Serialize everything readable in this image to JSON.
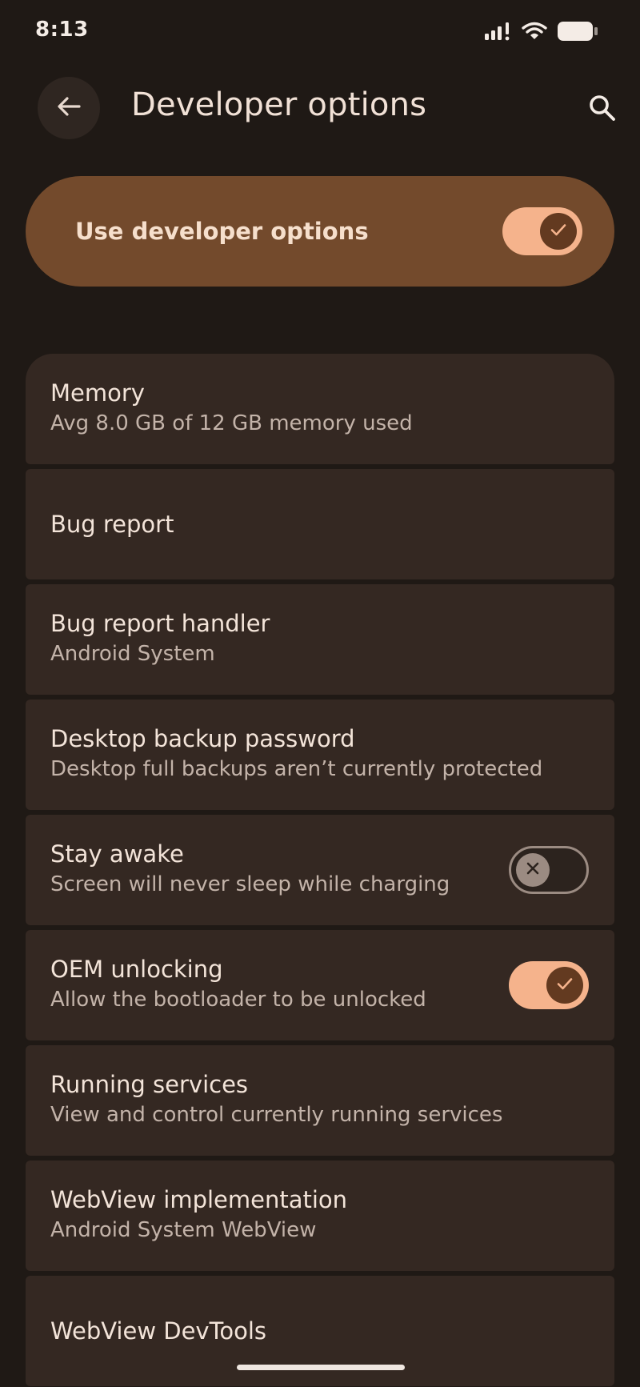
{
  "status": {
    "time": "8:13",
    "icons": [
      "signal-icon",
      "wifi-icon",
      "battery-icon"
    ]
  },
  "header": {
    "title": "Developer options",
    "back_icon": "arrow-back-icon",
    "search_icon": "search-icon"
  },
  "master": {
    "label": "Use developer options",
    "enabled": true
  },
  "settings": [
    {
      "title": "Memory",
      "subtitle": "Avg 8.0 GB of 12 GB memory used"
    },
    {
      "title": "Bug report",
      "subtitle": ""
    },
    {
      "title": "Bug report handler",
      "subtitle": "Android System"
    },
    {
      "title": "Desktop backup password",
      "subtitle": "Desktop full backups aren’t currently protected"
    },
    {
      "title": "Stay awake",
      "subtitle": "Screen will never sleep while charging",
      "toggle": false
    },
    {
      "title": "OEM unlocking",
      "subtitle": "Allow the bootloader to be unlocked",
      "toggle": true
    },
    {
      "title": "Running services",
      "subtitle": "View and control currently running services"
    },
    {
      "title": "WebView implementation",
      "subtitle": "Android System WebView"
    },
    {
      "title": "WebView DevTools",
      "subtitle": ""
    }
  ],
  "colors": {
    "background": "#1f1915",
    "card": "#342822",
    "accent": "#734a2c",
    "toggle_on": "#f5b38c"
  }
}
